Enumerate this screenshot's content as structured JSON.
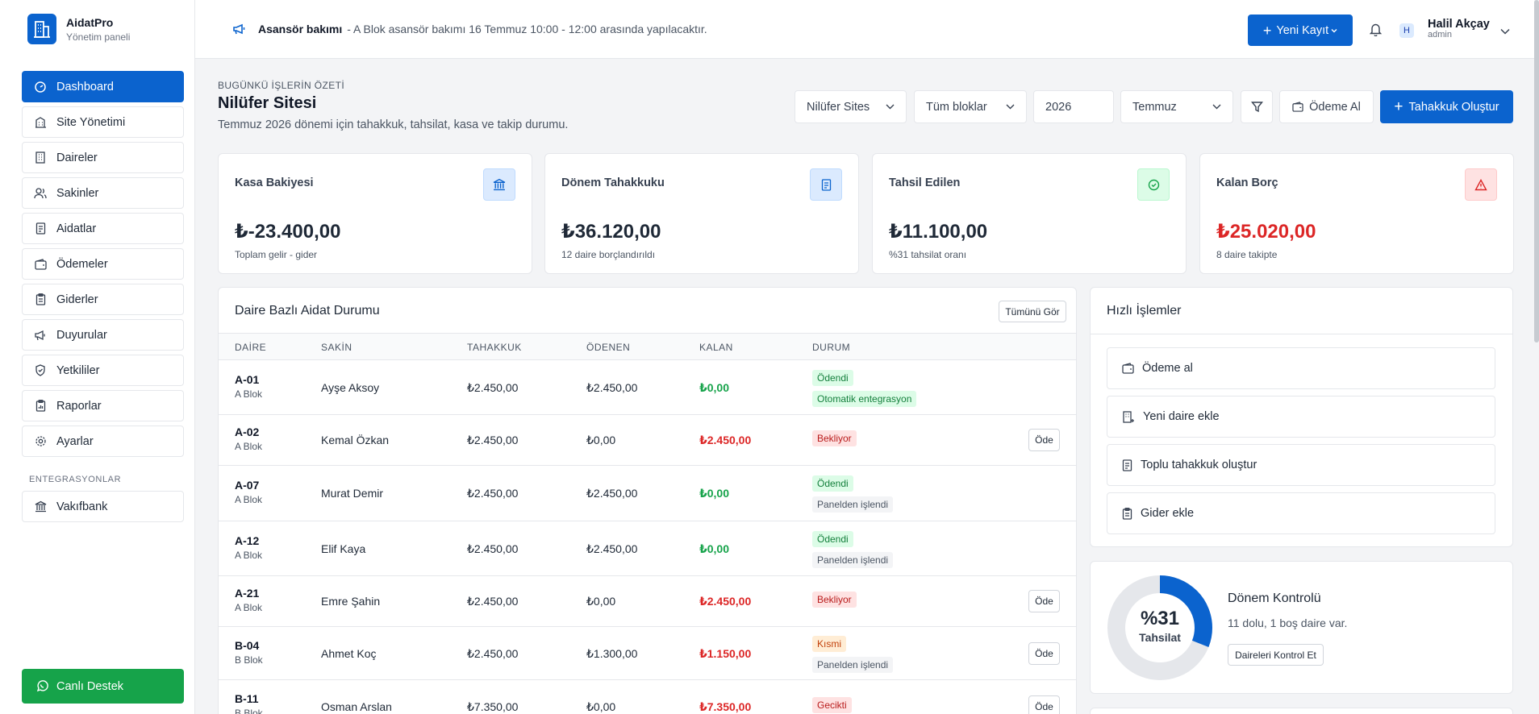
{
  "brand": {
    "name": "AidatPro",
    "subtitle": "Yönetim paneli"
  },
  "sidebar": {
    "items": [
      {
        "label": "Dashboard",
        "icon": "dashboard-icon",
        "active": true
      },
      {
        "label": "Site Yönetimi",
        "icon": "building-icon"
      },
      {
        "label": "Daireler",
        "icon": "apartment-icon"
      },
      {
        "label": "Sakinler",
        "icon": "users-icon"
      },
      {
        "label": "Aidatlar",
        "icon": "receipt-icon"
      },
      {
        "label": "Ödemeler",
        "icon": "wallet-icon"
      },
      {
        "label": "Giderler",
        "icon": "clipboard-icon"
      },
      {
        "label": "Duyurular",
        "icon": "megaphone-icon"
      },
      {
        "label": "Yetkililer",
        "icon": "shield-icon"
      },
      {
        "label": "Raporlar",
        "icon": "report-icon"
      },
      {
        "label": "Ayarlar",
        "icon": "gear-icon"
      }
    ],
    "section_label": "ENTEGRASYONLAR",
    "integration": {
      "label": "Vakıfbank",
      "icon": "bank-icon"
    },
    "support_label": "Canlı Destek"
  },
  "topbar": {
    "announcement_title": "Asansör bakımı",
    "announcement_text": "- A Blok asansör bakımı 16 Temmuz 10:00 - 12:00 arasında yapılacaktır.",
    "new_record_label": "Yeni Kayıt",
    "avatar_initial": "H",
    "user_name": "Halil Akçay",
    "user_role": "admin"
  },
  "header": {
    "eyebrow": "BUGÜNKÜ İŞLERİN ÖZETİ",
    "title": "Nilüfer Sitesi",
    "description": "Temmuz 2026 dönemi için tahakkuk, tahsilat, kasa ve takip durumu."
  },
  "filters": {
    "site": "Nilüfer Sites",
    "block": "Tüm bloklar",
    "year": "2026",
    "month": "Temmuz",
    "pay_label": "Ödeme Al",
    "accrual_label": "Tahakkuk Oluştur"
  },
  "kpis": [
    {
      "title": "Kasa Bakiyesi",
      "value": "₺-23.400,00",
      "sub": "Toplam gelir - gider",
      "icon": "bank-icon",
      "tone": "blue"
    },
    {
      "title": "Dönem Tahakkuku",
      "value": "₺36.120,00",
      "sub": "12 daire borçlandırıldı",
      "icon": "receipt-icon",
      "tone": "blue"
    },
    {
      "title": "Tahsil Edilen",
      "value": "₺11.100,00",
      "sub": "%31 tahsilat oranı",
      "icon": "check-circle-icon",
      "tone": "green"
    },
    {
      "title": "Kalan Borç",
      "value": "₺25.020,00",
      "sub": "8 daire takipte",
      "icon": "warning-icon",
      "tone": "red"
    }
  ],
  "dues_table": {
    "title": "Daire Bazlı Aidat Durumu",
    "view_all_label": "Tümünü Gör",
    "pay_button_label": "Öde",
    "columns": [
      "DAİRE",
      "SAKİN",
      "TAHAKKUK",
      "ÖDENEN",
      "KALAN",
      "DURUM"
    ],
    "rows": [
      {
        "unit": "A-01",
        "block": "A Blok",
        "resident": "Ayşe Aksoy",
        "accrued": "₺2.450,00",
        "paid": "₺2.450,00",
        "remaining": "₺0,00",
        "remaining_tone": "green",
        "statuses": [
          {
            "label": "Ödendi",
            "tone": "green"
          },
          {
            "label": "Otomatik entegrasyon",
            "tone": "green"
          }
        ],
        "pay": false
      },
      {
        "unit": "A-02",
        "block": "A Blok",
        "resident": "Kemal Özkan",
        "accrued": "₺2.450,00",
        "paid": "₺0,00",
        "remaining": "₺2.450,00",
        "remaining_tone": "red",
        "statuses": [
          {
            "label": "Bekliyor",
            "tone": "red"
          }
        ],
        "pay": true
      },
      {
        "unit": "A-07",
        "block": "A Blok",
        "resident": "Murat Demir",
        "accrued": "₺2.450,00",
        "paid": "₺2.450,00",
        "remaining": "₺0,00",
        "remaining_tone": "green",
        "statuses": [
          {
            "label": "Ödendi",
            "tone": "green"
          },
          {
            "label": "Panelden işlendi",
            "tone": "gray"
          }
        ],
        "pay": false
      },
      {
        "unit": "A-12",
        "block": "A Blok",
        "resident": "Elif Kaya",
        "accrued": "₺2.450,00",
        "paid": "₺2.450,00",
        "remaining": "₺0,00",
        "remaining_tone": "green",
        "statuses": [
          {
            "label": "Ödendi",
            "tone": "green"
          },
          {
            "label": "Panelden işlendi",
            "tone": "gray"
          }
        ],
        "pay": false
      },
      {
        "unit": "A-21",
        "block": "A Blok",
        "resident": "Emre Şahin",
        "accrued": "₺2.450,00",
        "paid": "₺0,00",
        "remaining": "₺2.450,00",
        "remaining_tone": "red",
        "statuses": [
          {
            "label": "Bekliyor",
            "tone": "red"
          }
        ],
        "pay": true
      },
      {
        "unit": "B-04",
        "block": "B Blok",
        "resident": "Ahmet Koç",
        "accrued": "₺2.450,00",
        "paid": "₺1.300,00",
        "remaining": "₺1.150,00",
        "remaining_tone": "red",
        "statuses": [
          {
            "label": "Kısmi",
            "tone": "orange"
          },
          {
            "label": "Panelden işlendi",
            "tone": "gray"
          }
        ],
        "pay": true
      },
      {
        "unit": "B-11",
        "block": "B Blok",
        "resident": "Osman Arslan",
        "accrued": "₺7.350,00",
        "paid": "₺0,00",
        "remaining": "₺7.350,00",
        "remaining_tone": "red",
        "statuses": [
          {
            "label": "Gecikti",
            "tone": "red"
          }
        ],
        "pay": true
      }
    ]
  },
  "quick_actions": {
    "title": "Hızlı İşlemler",
    "items": [
      {
        "label": "Ödeme al",
        "icon": "wallet-icon"
      },
      {
        "label": "Yeni daire ekle",
        "icon": "apartment-plus-icon"
      },
      {
        "label": "Toplu tahakkuk oluştur",
        "icon": "receipt-icon"
      },
      {
        "label": "Gider ekle",
        "icon": "clipboard-icon"
      }
    ]
  },
  "period_control": {
    "percent_label": "%31",
    "percent_value": 0.31,
    "center_caption": "Tahsilat",
    "title": "Dönem Kontrolü",
    "description": "11 dolu, 1 boş daire var.",
    "button_label": "Daireleri Kontrol Et"
  },
  "colors": {
    "primary": "#0b63ce",
    "success": "#16a34a",
    "danger": "#dc2626",
    "warning": "#c2410c"
  }
}
